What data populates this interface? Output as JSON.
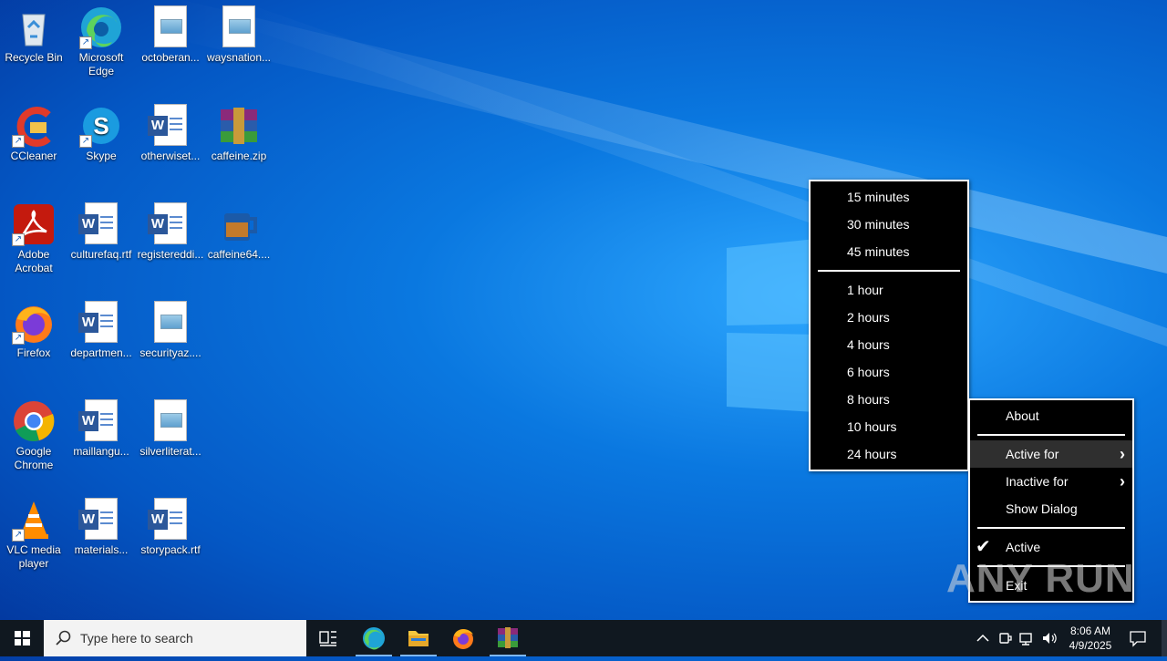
{
  "desktop": {
    "icons": [
      {
        "label": "Recycle Bin"
      },
      {
        "label": "Microsoft Edge"
      },
      {
        "label": "octoberan..."
      },
      {
        "label": "waysnation..."
      },
      {
        "label": "CCleaner"
      },
      {
        "label": "Skype"
      },
      {
        "label": "otherwiset..."
      },
      {
        "label": "caffeine.zip"
      },
      {
        "label": "Adobe Acrobat"
      },
      {
        "label": "culturefaq.rtf"
      },
      {
        "label": "registereddi..."
      },
      {
        "label": "caffeine64...."
      },
      {
        "label": "Firefox"
      },
      {
        "label": "departmen..."
      },
      {
        "label": "securityaz...."
      },
      {
        "label": "Google Chrome"
      },
      {
        "label": "maillangu..."
      },
      {
        "label": "silverliterat..."
      },
      {
        "label": "VLC media player"
      },
      {
        "label": "materials..."
      },
      {
        "label": "storypack.rtf"
      }
    ]
  },
  "submenu": {
    "items": [
      "15 minutes",
      "30 minutes",
      "45 minutes",
      "1 hour",
      "2 hours",
      "4 hours",
      "6 hours",
      "8 hours",
      "10 hours",
      "24 hours"
    ]
  },
  "context_menu": {
    "about": "About",
    "active_for": "Active for",
    "inactive_for": "Inactive for",
    "show_dialog": "Show Dialog",
    "active": "Active",
    "exit": "Exit",
    "checked_item": "active"
  },
  "taskbar": {
    "search_placeholder": "Type here to search",
    "time": "8:06 AM",
    "date": "4/9/2025"
  },
  "watermark": "ANY RUN",
  "colors": {
    "taskbar_bg": "#101820",
    "menu_bg": "#000000",
    "menu_fg": "#ffffff",
    "accent": "#0a78e0"
  }
}
